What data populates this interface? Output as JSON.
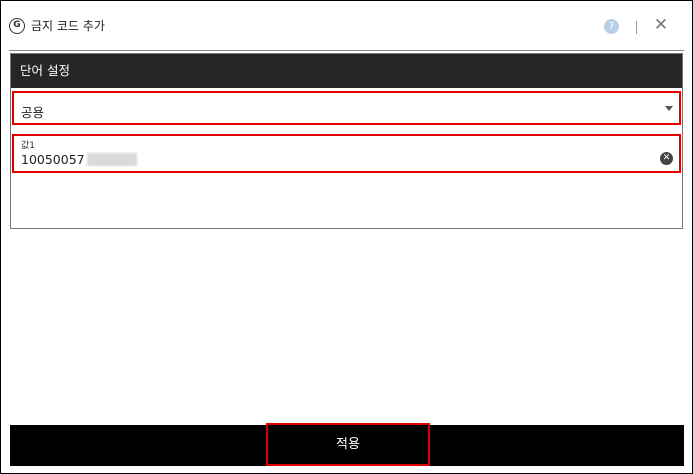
{
  "window": {
    "title": "금지 코드 추가",
    "app_icon_text": "G",
    "help_symbol": "?",
    "close_symbol": "✕"
  },
  "panel": {
    "header": "단어 설정",
    "select": {
      "value": "공용"
    },
    "value_field": {
      "label": "값1",
      "value": "10050057"
    }
  },
  "footer": {
    "apply_label": "적용"
  }
}
